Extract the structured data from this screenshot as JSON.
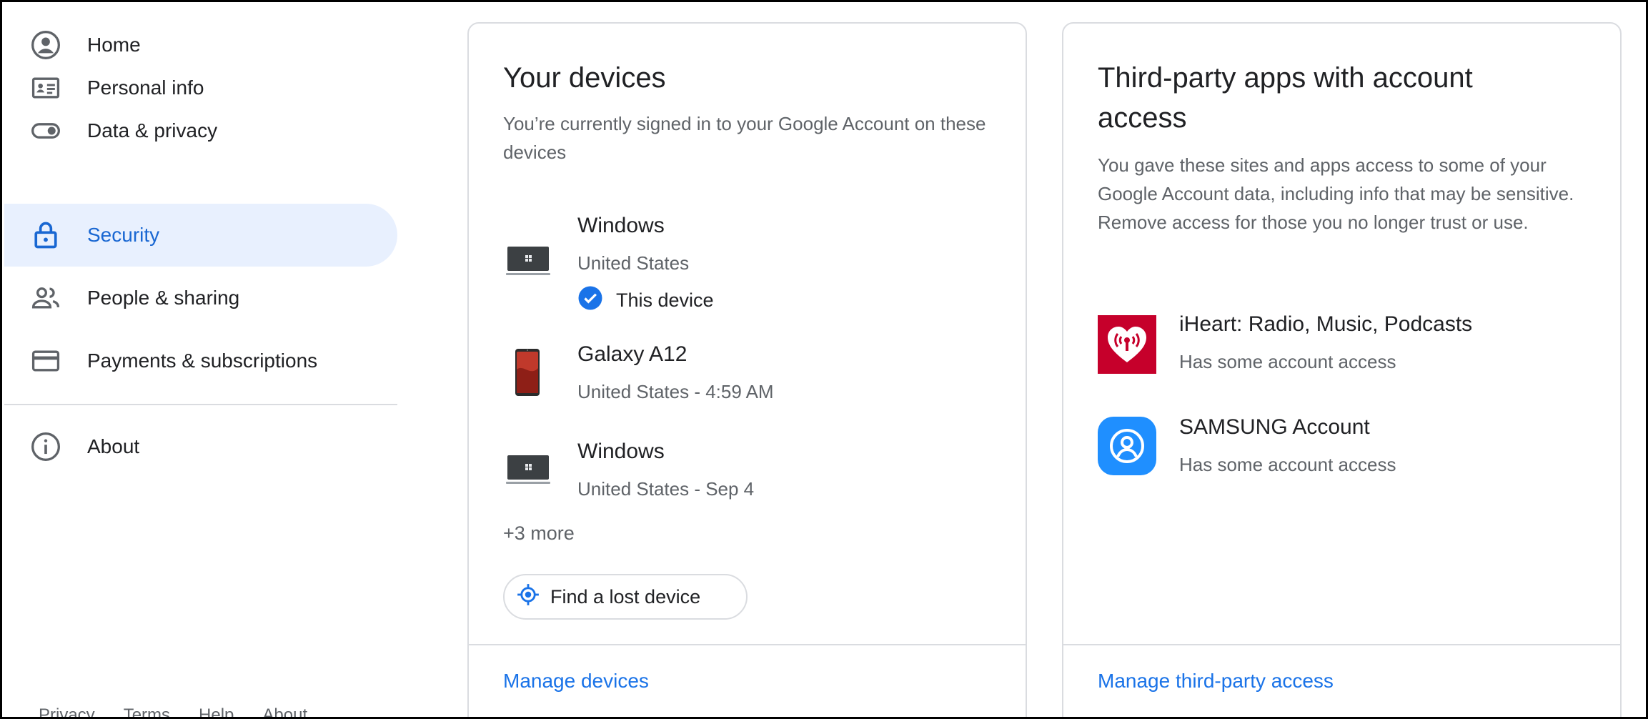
{
  "colors": {
    "accent": "#1a73e8",
    "active_bg": "#e8f0fe",
    "active_text": "#1967d2",
    "iheart_red": "#c6002b",
    "samsung_blue": "#1f8fff"
  },
  "sidebar": {
    "items": [
      {
        "label": "Home",
        "icon": "account-circle-icon"
      },
      {
        "label": "Personal info",
        "icon": "id-card-icon"
      },
      {
        "label": "Data & privacy",
        "icon": "toggle-icon"
      },
      {
        "label": "Security",
        "icon": "lock-icon",
        "active": true
      },
      {
        "label": "People & sharing",
        "icon": "people-icon"
      },
      {
        "label": "Payments & subscriptions",
        "icon": "credit-card-icon"
      },
      {
        "label": "About",
        "icon": "info-icon"
      }
    ],
    "footer": [
      "Privacy",
      "Terms",
      "Help",
      "About"
    ]
  },
  "devices_card": {
    "title": "Your devices",
    "description": "You’re currently signed in to your Google Account on these devices",
    "devices": [
      {
        "name": "Windows",
        "meta": "United States",
        "this_device": "This device",
        "icon": "laptop-icon"
      },
      {
        "name": "Galaxy A12",
        "meta": "United States - 4:59 AM",
        "icon": "phone-icon"
      },
      {
        "name": "Windows",
        "meta": "United States - Sep 4",
        "icon": "laptop-icon"
      }
    ],
    "more": "+3 more",
    "find_button": "Find a lost device",
    "manage_link": "Manage devices"
  },
  "apps_card": {
    "title_line1": "Third-party apps with account",
    "title_line2": "access",
    "description": "You gave these sites and apps access to some of your Google Account data, including info that may be sensitive. Remove access for those you no longer trust or use.",
    "apps": [
      {
        "name": "iHeart: Radio, Music, Podcasts",
        "meta": "Has some account access",
        "icon": "iheart-logo"
      },
      {
        "name": "SAMSUNG Account",
        "meta": "Has some account access",
        "icon": "samsung-account-logo"
      }
    ],
    "manage_link": "Manage third-party access"
  }
}
